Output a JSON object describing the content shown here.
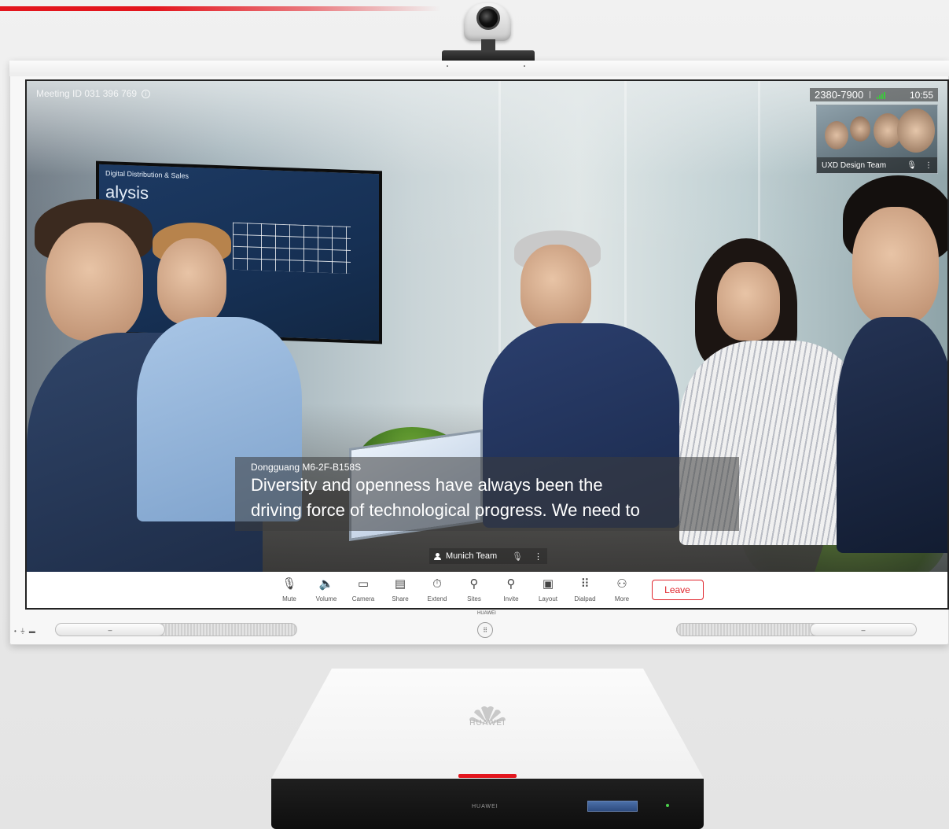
{
  "meeting": {
    "meeting_id": "Meeting ID 031 396 769",
    "number": "2380-7900",
    "time": "10:55"
  },
  "pip": {
    "site_name": "UXD Design Team"
  },
  "caption": {
    "speaker": "Dongguang M6-2F-B158S",
    "lines": [
      "Diversity and openness have always been the",
      "driving force of technological progress. We need to"
    ]
  },
  "active_speaker": {
    "name": "Munich Team"
  },
  "toolbar": {
    "items": [
      {
        "label": "Mute",
        "icon": "microphone-icon",
        "glyph": "🎙"
      },
      {
        "label": "Volume",
        "icon": "speaker-icon",
        "glyph": "🔈"
      },
      {
        "label": "Camera",
        "icon": "camera-icon",
        "glyph": "▭"
      },
      {
        "label": "Share",
        "icon": "share-icon",
        "glyph": "▤"
      },
      {
        "label": "Extend",
        "icon": "stopwatch-icon",
        "glyph": "⏱"
      },
      {
        "label": "Sites",
        "icon": "person-icon",
        "glyph": "⚲"
      },
      {
        "label": "Invite",
        "icon": "add-person-icon",
        "glyph": "⚲"
      },
      {
        "label": "Layout",
        "icon": "layout-icon",
        "glyph": "▣"
      },
      {
        "label": "Dialpad",
        "icon": "dialpad-icon",
        "glyph": "⠿"
      },
      {
        "label": "More",
        "icon": "group-icon",
        "glyph": "⚇"
      }
    ],
    "leave_label": "Leave"
  },
  "hardware": {
    "display_brand": "HUAWEI",
    "codec_brand": "HUAWEI"
  },
  "colors": {
    "accent_red": "#e3161e",
    "signal_green": "#3ec63e"
  }
}
